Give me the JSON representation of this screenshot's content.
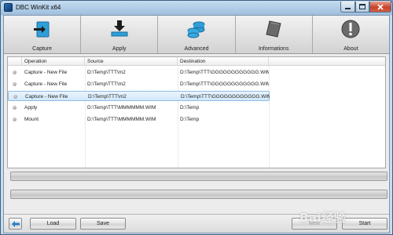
{
  "window": {
    "title": "DBC WinKit x64"
  },
  "toolbar": {
    "items": [
      {
        "label": "Capture",
        "icon": "capture-icon"
      },
      {
        "label": "Apply",
        "icon": "apply-icon"
      },
      {
        "label": "Advanced",
        "icon": "advanced-icon"
      },
      {
        "label": "Informations",
        "icon": "informations-icon"
      },
      {
        "label": "About",
        "icon": "about-icon"
      }
    ]
  },
  "table": {
    "headers": {
      "operation": "Operation",
      "source": "Source",
      "destination": "Destination"
    },
    "rows": [
      {
        "operation": "Capture - New File",
        "source": "D:\\Temp\\TTT\\m2",
        "destination": "D:\\Temp\\TTT\\GGGGGGGGGGGG.WIM",
        "selected": false
      },
      {
        "operation": "Capture - New File",
        "source": "D:\\Temp\\TTT\\m2",
        "destination": "D:\\Temp\\TTT\\GGGGGGGGGGGG.WIM",
        "selected": false
      },
      {
        "operation": "Capture - New File",
        "source": "D:\\Temp\\TTT\\m2",
        "destination": "D:\\Temp\\TTT\\GGGGGGGGGGGG.WIM",
        "selected": true
      },
      {
        "operation": "Apply",
        "source": "D:\\Temp\\TTT\\MMMMMM.WIM",
        "destination": "D:\\Temp",
        "selected": false
      },
      {
        "operation": "Mount",
        "source": "D:\\Temp\\TTT\\MMMMMM.WIM",
        "destination": "D:\\Temp",
        "selected": false
      }
    ]
  },
  "progress": {
    "bar1": 0,
    "bar2": 0
  },
  "buttons": {
    "load": "Load",
    "save": "Save",
    "next": "Next",
    "start": "Start"
  },
  "watermark": "Bai经验"
}
